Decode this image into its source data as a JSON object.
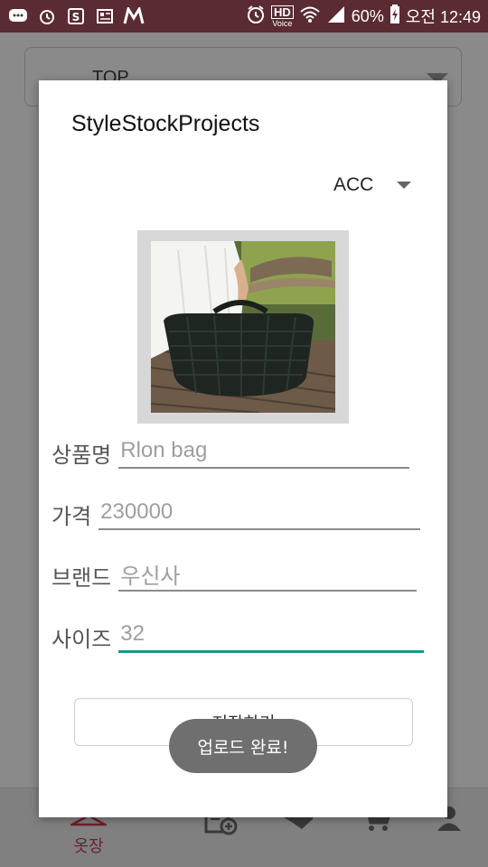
{
  "status_bar": {
    "left_icons": [
      "chat-icon",
      "alarm-icon",
      "shopping-icon",
      "news-icon",
      "m-app-icon"
    ],
    "hd_label": "HD",
    "voice_label": "Voice",
    "battery": "60%",
    "time": "오전 12:49"
  },
  "background": {
    "spinner_value": "TOP",
    "nav": {
      "closet_label": "옷장"
    }
  },
  "dialog": {
    "title": "StyleStockProjects",
    "category": "ACC",
    "fields": {
      "name": {
        "label": "상품명",
        "value": "Rlon bag"
      },
      "price": {
        "label": "가격",
        "value": "230000"
      },
      "brand": {
        "label": "브랜드",
        "value": "우신사"
      },
      "size": {
        "label": "사이즈",
        "value": "32"
      }
    },
    "save_label": "저장하기"
  },
  "toast": {
    "message": "업로드 완료!"
  },
  "colors": {
    "status_bar": "#5b2b33",
    "accent": "#1a9688",
    "nav_active": "#6d1f2b"
  }
}
